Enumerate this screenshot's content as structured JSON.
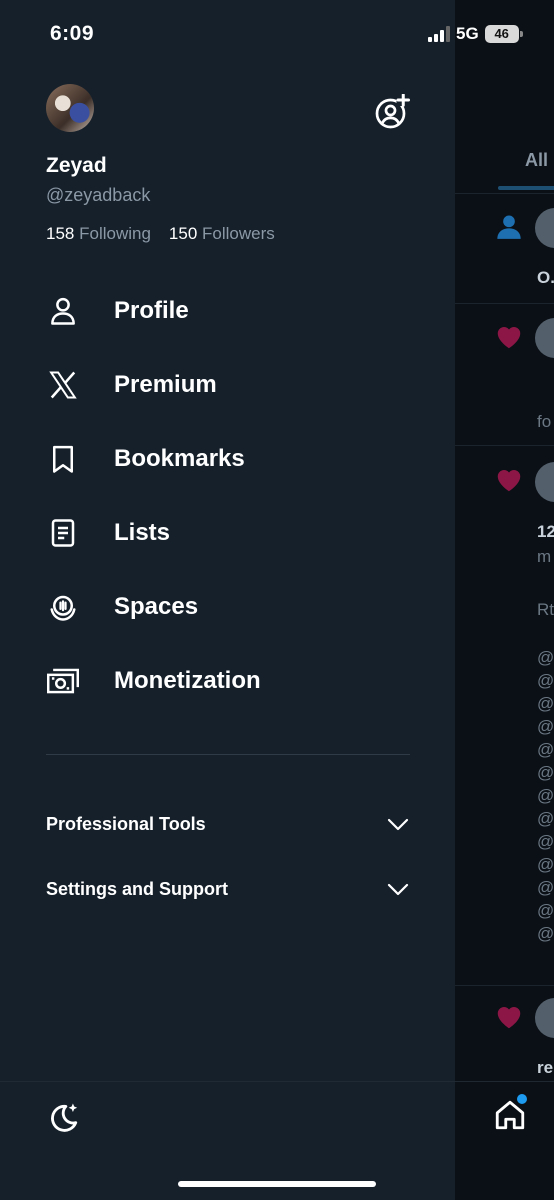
{
  "status_bar": {
    "time": "6:09",
    "network": "5G",
    "battery": "46"
  },
  "profile": {
    "display_name": "Zeyad",
    "handle": "@zeyadback",
    "following_count": "158",
    "following_label": "Following",
    "followers_count": "150",
    "followers_label": "Followers"
  },
  "menu": {
    "items": [
      {
        "label": "Profile",
        "icon": "person-icon"
      },
      {
        "label": "Premium",
        "icon": "x-logo-icon"
      },
      {
        "label": "Bookmarks",
        "icon": "bookmark-icon"
      },
      {
        "label": "Lists",
        "icon": "list-icon"
      },
      {
        "label": "Spaces",
        "icon": "spaces-icon"
      },
      {
        "label": "Monetization",
        "icon": "money-icon"
      }
    ]
  },
  "sections": {
    "professional_tools": "Professional Tools",
    "settings_support": "Settings and Support"
  },
  "background": {
    "tab_all": "All",
    "snippets": [
      "O.",
      "fo",
      "12",
      "m",
      "Rt",
      "@",
      "@",
      "@",
      "@",
      "@",
      "@",
      "@",
      "@",
      "@",
      "@",
      "@",
      "@",
      "@",
      "re"
    ]
  },
  "colors": {
    "background": "#15202b",
    "accent": "#1d9bf0",
    "secondary_text": "#8b98a5",
    "like": "#f91880"
  }
}
